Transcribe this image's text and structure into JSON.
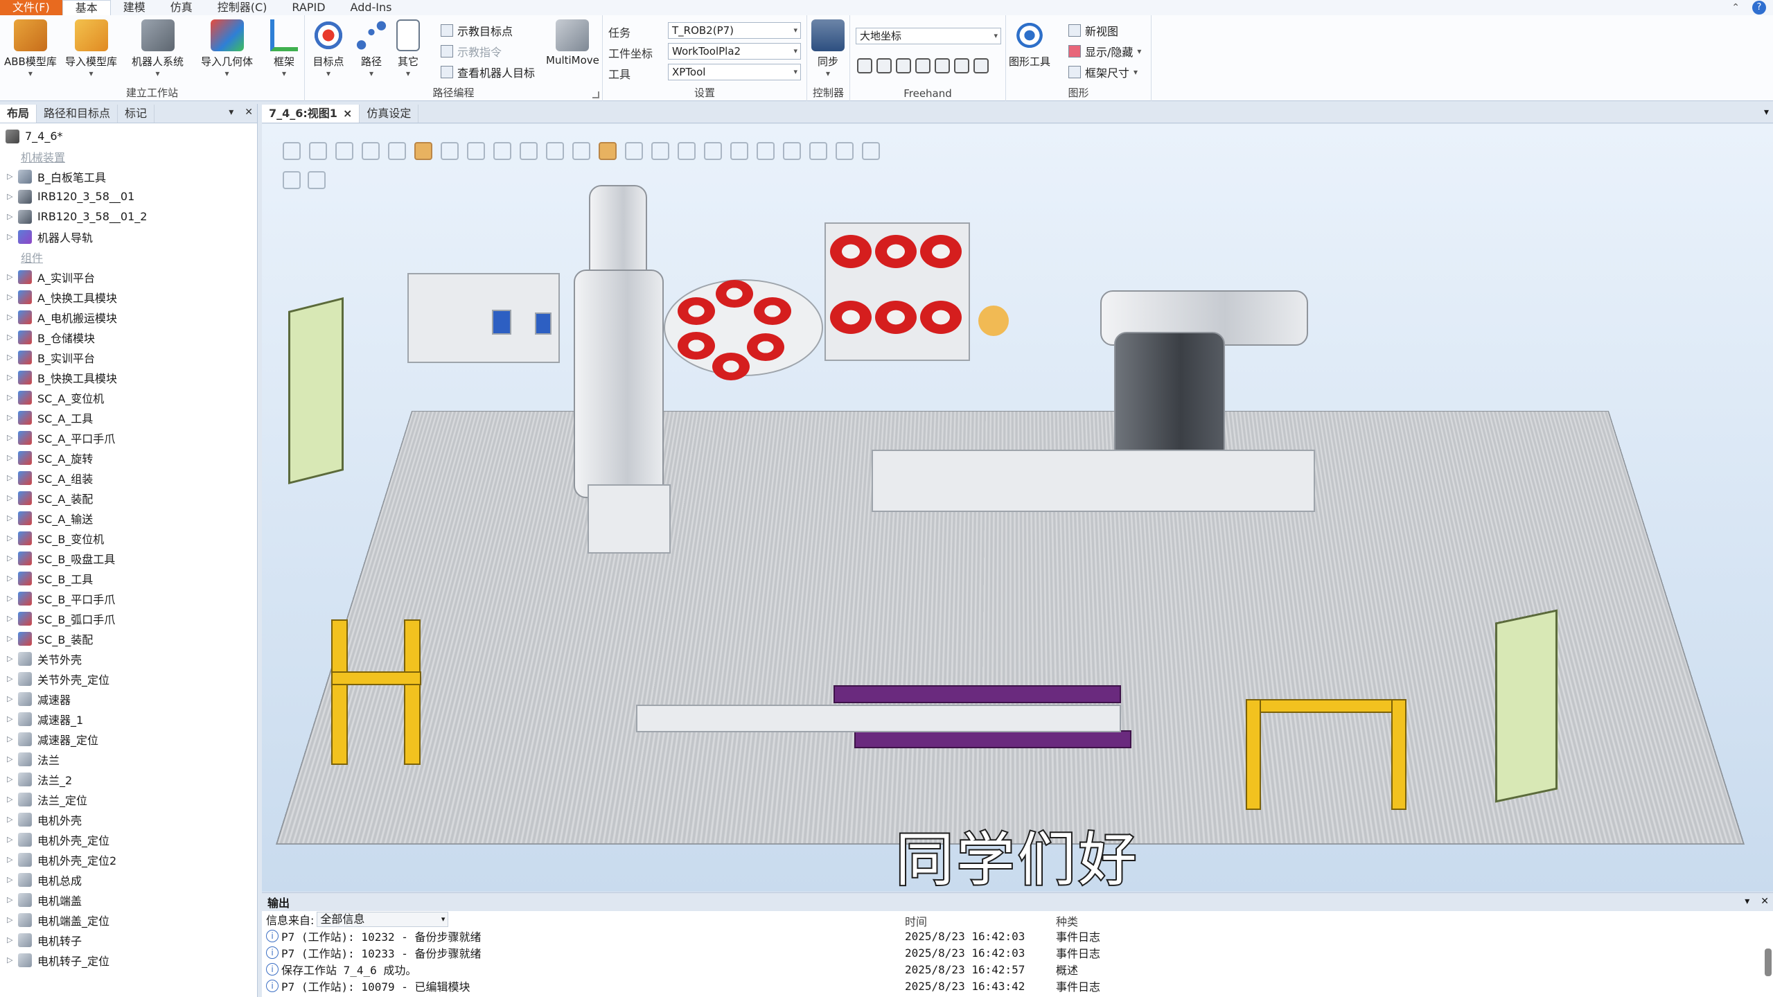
{
  "menu": {
    "tabs": [
      "文件(F)",
      "基本",
      "建模",
      "仿真",
      "控制器(C)",
      "RAPID",
      "Add-Ins"
    ],
    "active": "基本"
  },
  "ribbon": {
    "build_station": {
      "label": "建立工作站",
      "buttons": [
        "ABB模型库",
        "导入模型库",
        "机器人系统",
        "导入几何体",
        "框架"
      ]
    },
    "path_programming": {
      "label": "路径编程",
      "buttons": [
        "目标点",
        "路径",
        "其它"
      ],
      "small": [
        "示教目标点",
        "示教指令",
        "查看机器人目标"
      ],
      "multimove": "MultiMove"
    },
    "settings": {
      "label": "设置",
      "task_label": "任务",
      "task_value": "T_ROB2(P7)",
      "wobj_label": "工件坐标",
      "wobj_value": "WorkToolPla2",
      "tool_label": "工具",
      "tool_value": "XPTool"
    },
    "controller": {
      "label": "控制器",
      "sync": "同步"
    },
    "freehand": {
      "label": "Freehand",
      "coord": "大地坐标"
    },
    "graphics": {
      "label": "图形",
      "tools": "图形工具",
      "new_view": "新视图",
      "show_hide": "显示/隐藏",
      "frame_size": "框架尺寸"
    }
  },
  "left_panel": {
    "tabs": [
      "布局",
      "路径和目标点",
      "标记"
    ],
    "root": "7_4_6*",
    "sections": {
      "mechanisms": "机械装置",
      "components": "组件"
    },
    "mechanisms": [
      {
        "name": "B_白板笔工具",
        "icon": "tool-icon"
      },
      {
        "name": "IRB120_3_58__01",
        "icon": "robot-icon"
      },
      {
        "name": "IRB120_3_58__01_2",
        "icon": "robot-icon"
      },
      {
        "name": "机器人导轨",
        "icon": "track-icon"
      }
    ],
    "components": [
      "A_实训平台",
      "A_快换工具模块",
      "A_电机搬运模块",
      "B_仓储模块",
      "B_实训平台",
      "B_快换工具模块",
      "SC_A_变位机",
      "SC_A_工具",
      "SC_A_平口手爪",
      "SC_A_旋转",
      "SC_A_组装",
      "SC_A_装配",
      "SC_A_输送",
      "SC_B_变位机",
      "SC_B_吸盘工具",
      "SC_B_工具",
      "SC_B_平口手爪",
      "SC_B_弧口手爪",
      "SC_B_装配",
      "关节外壳",
      "关节外壳_定位",
      "减速器",
      "减速器_1",
      "减速器_定位",
      "法兰",
      "法兰_2",
      "法兰_定位",
      "电机外壳",
      "电机外壳_定位",
      "电机外壳_定位2",
      "电机总成",
      "电机端盖",
      "电机端盖_定位",
      "电机转子",
      "电机转子_定位"
    ]
  },
  "doc_tabs": [
    {
      "label": "7_4_6:视图1",
      "active": true,
      "close": "×"
    },
    {
      "label": "仿真设定",
      "active": false
    }
  ],
  "viewport": {
    "subtitle": "同学们好"
  },
  "output": {
    "title": "输出",
    "filter_label": "信息来自:",
    "filter_value": "全部信息",
    "col_time": "时间",
    "col_category": "种类",
    "rows": [
      {
        "msg": "P7 (工作站): 10232 - 备份步骤就绪",
        "time": "2025/8/23 16:42:03",
        "cat": "事件日志"
      },
      {
        "msg": "P7 (工作站): 10233 - 备份步骤就绪",
        "time": "2025/8/23 16:42:03",
        "cat": "事件日志"
      },
      {
        "msg": "保存工作站 7_4_6 成功。",
        "time": "2025/8/23 16:42:57",
        "cat": "概述"
      },
      {
        "msg": "P7 (工作站): 10079 - 已编辑模块",
        "time": "2025/8/23 16:43:42",
        "cat": "事件日志"
      }
    ]
  }
}
